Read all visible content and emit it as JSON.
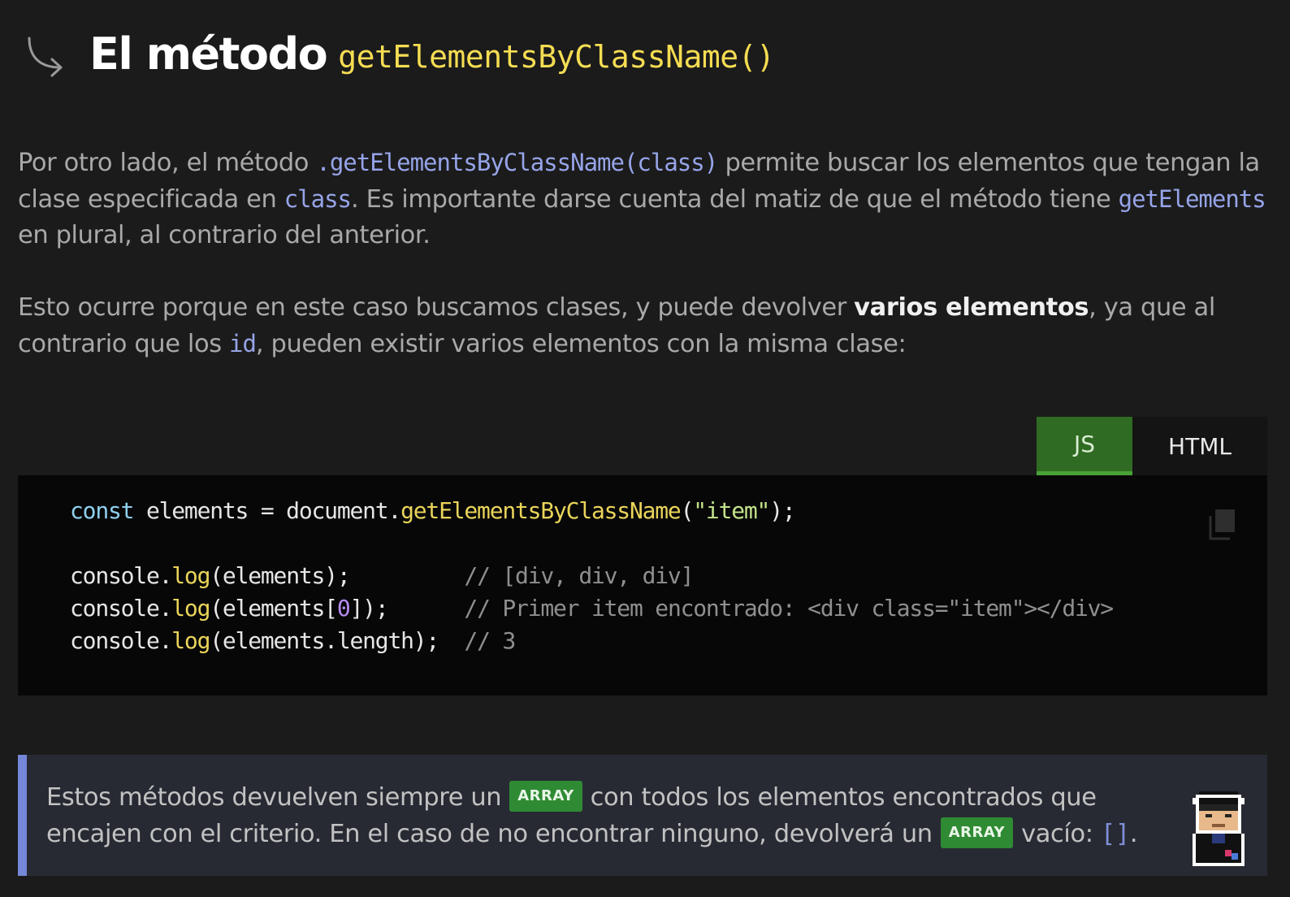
{
  "heading": {
    "title_text": "El método",
    "title_code": "getElementsByClassName()",
    "icon": "arrow-down-right-icon"
  },
  "paragraph1": {
    "t1": "Por otro lado, el método ",
    "c1": ".getElementsByClassName(class)",
    "t2": " permite buscar los elementos que tengan la clase especificada en ",
    "c2": "class",
    "t3": ". Es importante darse cuenta del matiz de que el método tiene ",
    "c3": "getElements",
    "t4": " en plural, al contrario del anterior."
  },
  "paragraph2": {
    "t1": "Esto ocurre porque en este caso buscamos clases, y puede devolver ",
    "b1": "varios elementos",
    "t2": ", ya que al contrario que los ",
    "c1": "id",
    "t3": ", pueden existir varios elementos con la misma clase:"
  },
  "tabs": [
    {
      "label": "JS",
      "active": true
    },
    {
      "label": "HTML",
      "active": false
    }
  ],
  "code": {
    "line1": {
      "kw": "const",
      "a": " elements = document.",
      "fn": "getElementsByClassName",
      "b": "(",
      "str": "\"item\"",
      "c": ");"
    },
    "line3": {
      "a": "console.",
      "fn": "log",
      "b": "(elements);         ",
      "cm": "// [div, div, div]"
    },
    "line4": {
      "a": "console.",
      "fn": "log",
      "b": "(elements[",
      "num": "0",
      "c": "]);      ",
      "cm": "// Primer item encontrado: <div class=\"item\"></div>"
    },
    "line5": {
      "a": "console.",
      "fn": "log",
      "b": "(elements.length);  ",
      "cm": "// 3"
    },
    "copy_icon": "copy-icon"
  },
  "callout": {
    "t1": "Estos métodos devuelven siempre un",
    "badge1": "ARRAY",
    "t2": "con todos los elementos encontrados que encajen con el criterio. En el caso de no encontrar ninguno, devolverá un",
    "badge2": "ARRAY",
    "t3": "vacío: ",
    "code": "[]",
    "t4": ".",
    "avatar_icon": "pixel-avatar-icon"
  },
  "colors": {
    "background": "#1b1b1b",
    "title_code": "#f5dd53",
    "inline_code": "#96a4e8",
    "tab_active": "#2f6b22",
    "badge": "#2f8a34",
    "callout_border": "#7587d8"
  }
}
